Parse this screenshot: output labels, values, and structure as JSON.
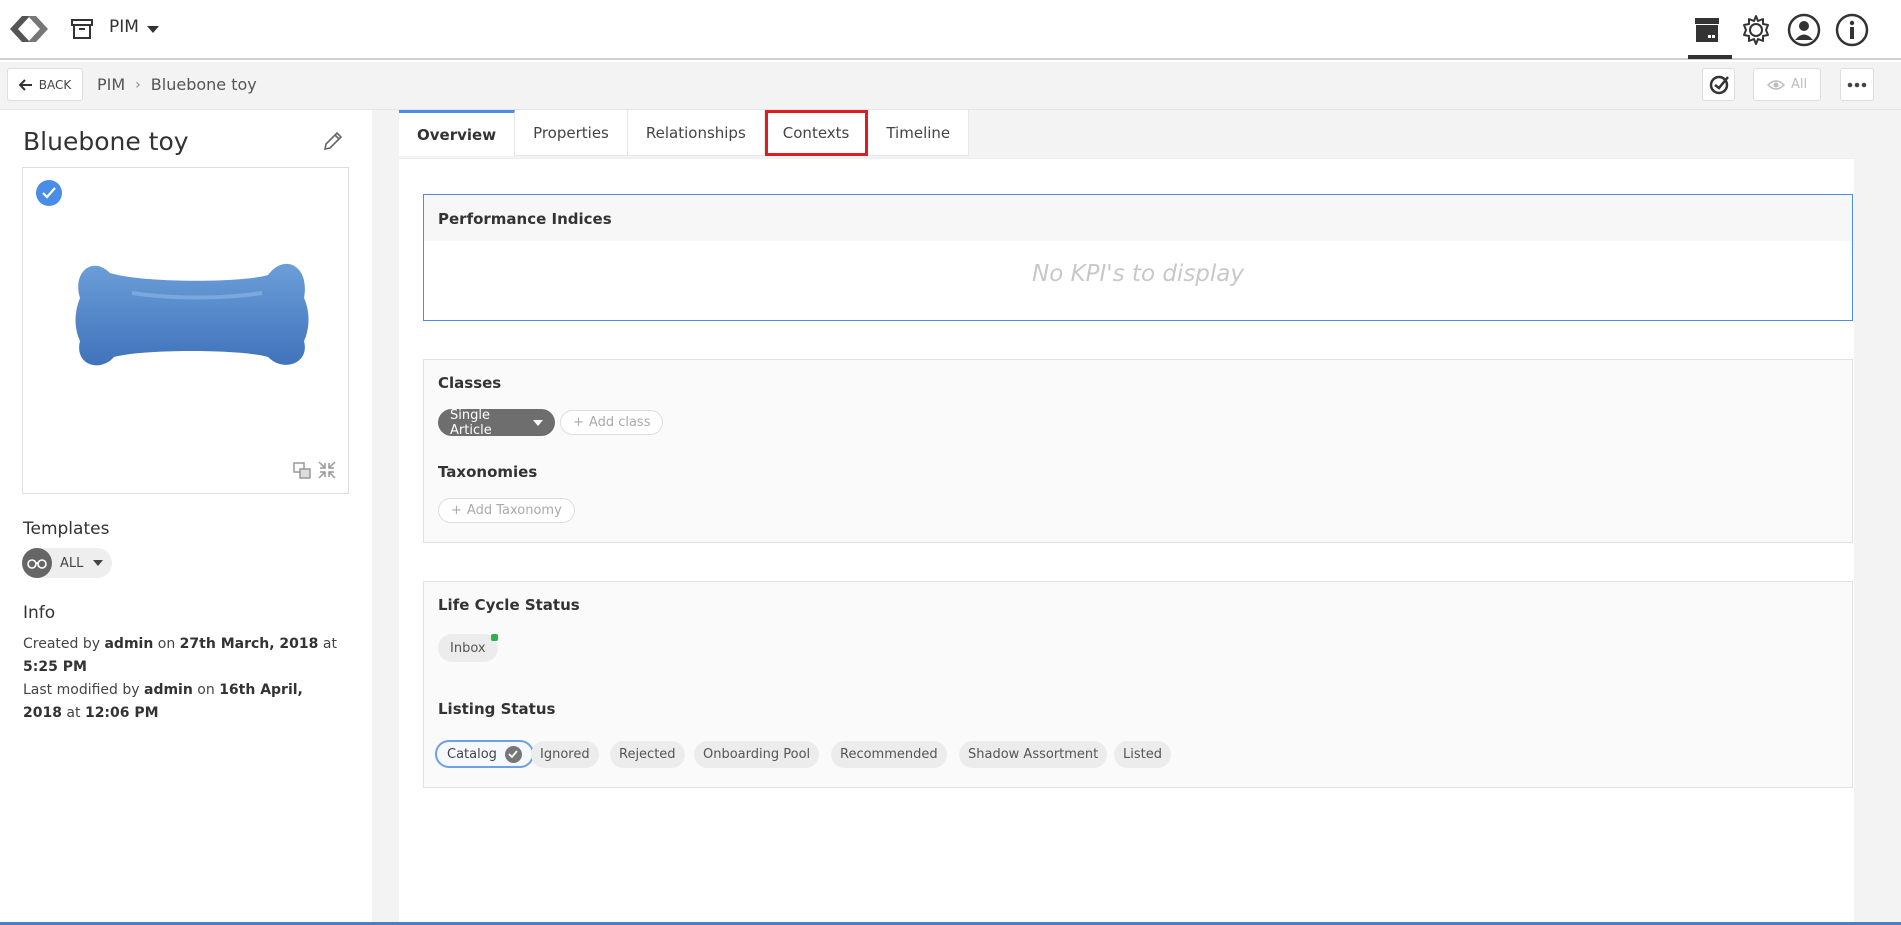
{
  "header": {
    "module_name": "PIM"
  },
  "subbar": {
    "back_label": "BACK",
    "breadcrumb": [
      "PIM",
      "Bluebone toy"
    ],
    "view_filter_label": "All"
  },
  "product": {
    "title": "Bluebone toy"
  },
  "templates": {
    "heading": "Templates",
    "value": "ALL"
  },
  "info": {
    "heading": "Info",
    "created_prefix": "Created by",
    "created_by": "admin",
    "created_on_word": "on",
    "created_date": "27th March, 2018",
    "created_at_word": "at",
    "created_time": "5:25 PM",
    "modified_prefix": "Last modified by",
    "modified_by": "admin",
    "modified_on_word": "on",
    "modified_date": "16th April, 2018",
    "modified_at_word": "at",
    "modified_time": "12:06 PM"
  },
  "tabs": [
    {
      "label": "Overview"
    },
    {
      "label": "Properties"
    },
    {
      "label": "Relationships"
    },
    {
      "label": "Contexts"
    },
    {
      "label": "Timeline"
    }
  ],
  "performance": {
    "title": "Performance Indices",
    "empty_text": "No KPI's to display"
  },
  "classes": {
    "title": "Classes",
    "class_chip": "Single Article",
    "add_class": "Add class",
    "taxonomies_title": "Taxonomies",
    "add_taxonomy": "Add Taxonomy"
  },
  "lifecycle": {
    "title": "Life Cycle Status",
    "status": "Inbox",
    "listing_title": "Listing Status",
    "listing_options": [
      "Catalog",
      "Ignored",
      "Rejected",
      "Onboarding Pool",
      "Recommended",
      "Shadow Assortment",
      "Listed"
    ]
  },
  "colors": {
    "accent": "#4a8de8",
    "highlight": "#e01b24",
    "status_dot": "#2bb24c"
  },
  "icons": [
    "logo-icon",
    "archive-icon",
    "store-icon",
    "gear-icon",
    "user-icon",
    "info-icon",
    "arrow-left-icon",
    "check-circle-icon",
    "eye-icon",
    "more-icon",
    "pencil-icon",
    "compare-icon",
    "collapse-icon",
    "glasses-icon",
    "plus-icon"
  ]
}
